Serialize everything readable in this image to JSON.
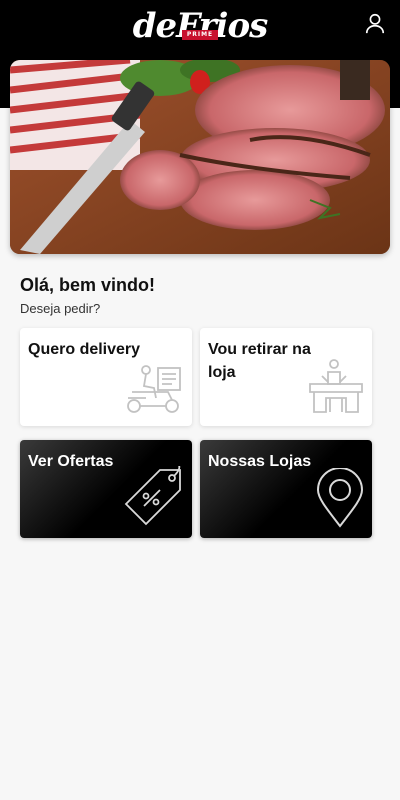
{
  "header": {
    "logo_text": "deFrios",
    "logo_tag": "PRIME",
    "profile_icon": "user-icon"
  },
  "hero": {
    "image": "roast-beef-photo"
  },
  "welcome": {
    "title": "Olá, bem vindo!",
    "subtitle": "Deseja pedir?"
  },
  "cards": [
    {
      "label": "Quero delivery",
      "icon": "delivery-scooter-icon"
    },
    {
      "label": "Vou retirar na loja",
      "icon": "store-pickup-icon"
    },
    {
      "label": "Ver Ofertas",
      "icon": "discount-tag-icon"
    },
    {
      "label": "Nossas Lojas",
      "icon": "map-pin-icon"
    }
  ],
  "colors": {
    "header_bg": "#000000",
    "brand_red": "#c8102e",
    "page_bg": "#f7f7f7"
  }
}
